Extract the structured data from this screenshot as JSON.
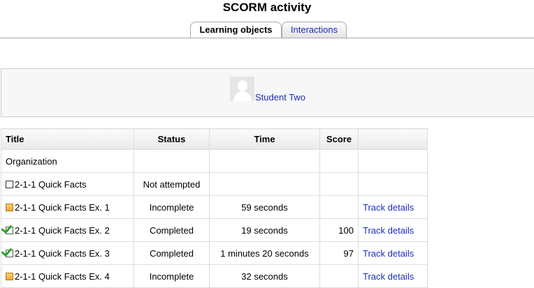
{
  "page": {
    "title": "SCORM activity"
  },
  "tabs": [
    {
      "label": "Learning objects",
      "active": true
    },
    {
      "label": "Interactions",
      "active": false
    }
  ],
  "user": {
    "name": "Student Two",
    "avatar_icon": "user-avatar-icon"
  },
  "table": {
    "headers": {
      "title": "Title",
      "status": "Status",
      "time": "Time",
      "score": "Score"
    },
    "rows": [
      {
        "title": "Organization",
        "status": "",
        "time": "",
        "score": "",
        "action": "",
        "icon": ""
      },
      {
        "title": "2-1-1 Quick Facts",
        "status": "Not attempted",
        "time": "",
        "score": "",
        "action": "",
        "icon": "not-attempted-icon"
      },
      {
        "title": "2-1-1 Quick Facts Ex. 1",
        "status": "Incomplete",
        "time": "59 seconds",
        "score": "",
        "action": "Track details",
        "icon": "incomplete-icon"
      },
      {
        "title": "2-1-1 Quick Facts Ex. 2",
        "status": "Completed",
        "time": "19 seconds",
        "score": "100",
        "action": "Track details",
        "icon": "completed-icon"
      },
      {
        "title": "2-1-1 Quick Facts Ex. 3",
        "status": "Completed",
        "time": "1 minutes 20 seconds",
        "score": "97",
        "action": "Track details",
        "icon": "completed-icon"
      },
      {
        "title": "2-1-1 Quick Facts Ex. 4",
        "status": "Incomplete",
        "time": "32 seconds",
        "score": "",
        "action": "Track details",
        "icon": "incomplete-icon"
      }
    ]
  },
  "colors": {
    "link": "#1a2eb8",
    "incomplete": "#f0a63a",
    "completed_check": "#2aa52a"
  }
}
